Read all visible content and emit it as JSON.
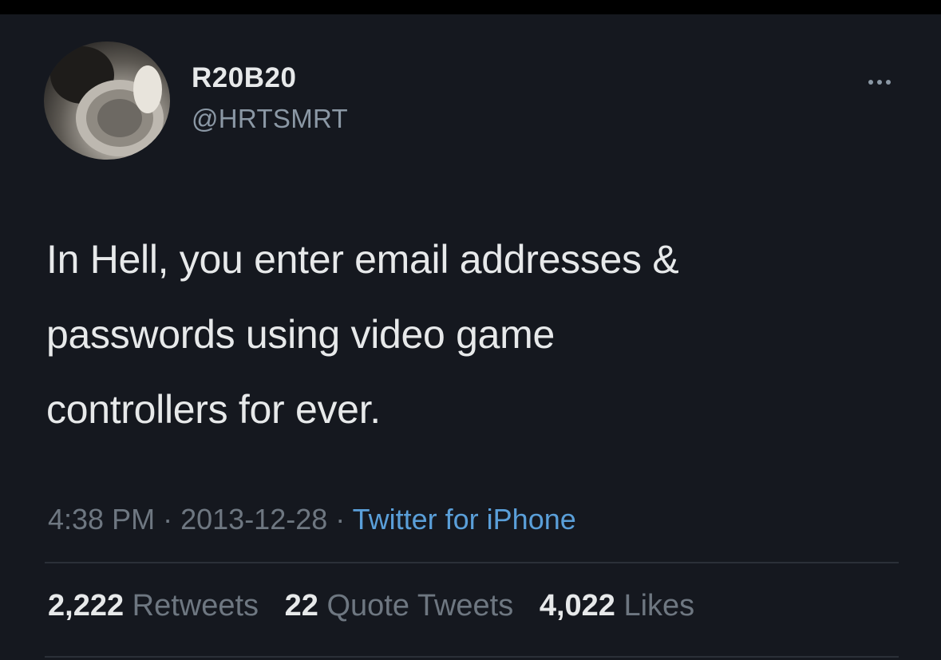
{
  "user": {
    "display_name": "R20B20",
    "handle": "@HRTSMRT",
    "avatar_icon": "profile-photo"
  },
  "more_icon": "more-options-icon",
  "tweet": {
    "lines": [
      "In Hell, you enter email addresses &",
      "passwords using video game",
      "controllers for ever."
    ]
  },
  "meta": {
    "time": "4:38 PM",
    "separator": "·",
    "date": "2013-12-28",
    "source": "Twitter for iPhone"
  },
  "stats": {
    "retweets_count": "2,222",
    "retweets_label": "Retweets",
    "quotes_count": "22",
    "quotes_label": "Quote Tweets",
    "likes_count": "4,022",
    "likes_label": "Likes"
  },
  "colors": {
    "background": "#15181f",
    "text": "#e7e9ea",
    "muted": "#6e7781",
    "link": "#5a9fd9"
  }
}
